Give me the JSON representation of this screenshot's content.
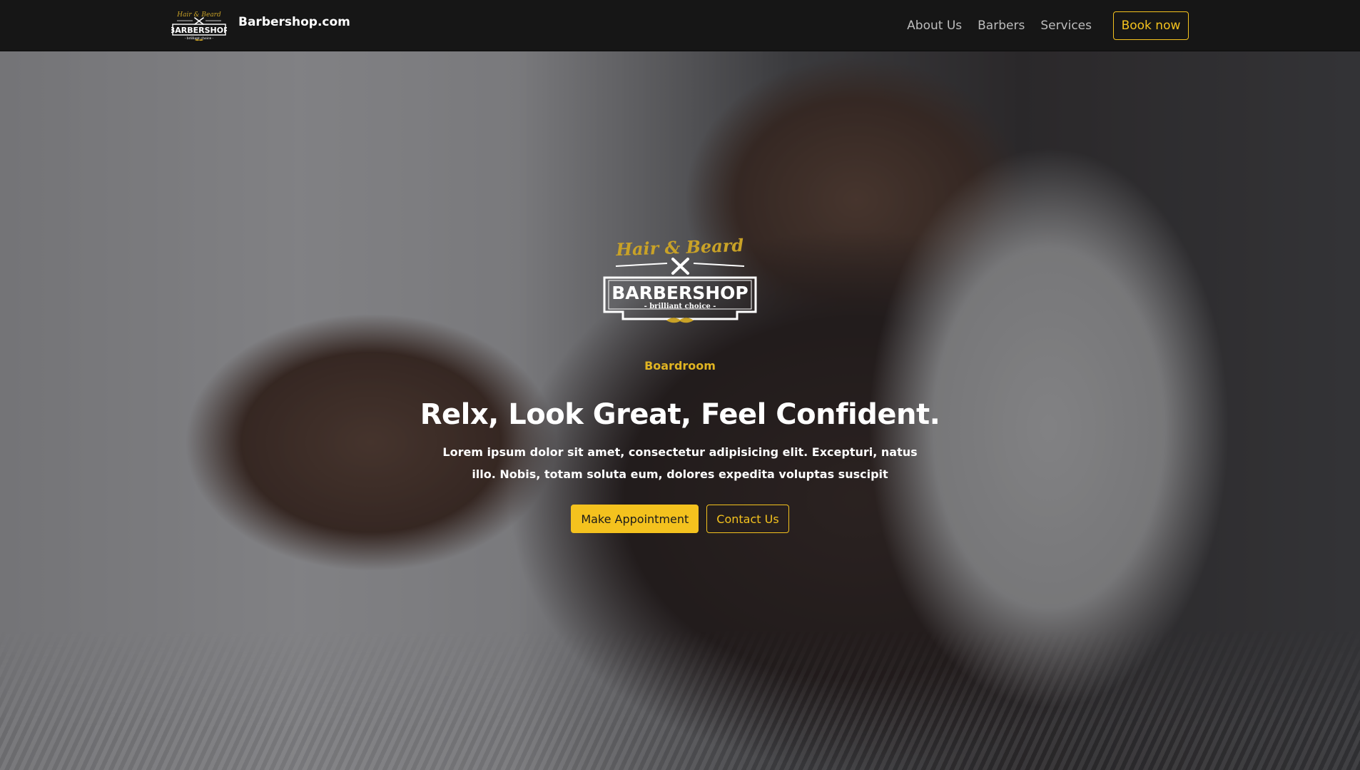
{
  "brand": {
    "name": "Barbershop.com",
    "logo": {
      "script": "Hair & Beard",
      "word": "BARBERSHOP",
      "tagline": "- brilliant choice -",
      "icon": "crossed-razors-icon"
    }
  },
  "nav": {
    "links": [
      {
        "label": "About Us"
      },
      {
        "label": "Barbers"
      },
      {
        "label": "Services"
      }
    ],
    "cta_label": "Book now"
  },
  "hero": {
    "logo": {
      "script": "Hair & Beard",
      "word": "BARBERSHOP",
      "tagline": "- brilliant choice -",
      "icon": "crossed-razors-icon",
      "mustache": "mustache-icon"
    },
    "eyebrow": "Boardroom",
    "headline": "Relx, Look Great, Feel Confident.",
    "subtext": "Lorem ipsum dolor sit amet, consectetur adipisicing elit. Excepturi, natus illo. Nobis, totam soluta eum, dolores expedita voluptas suscipit",
    "primary_cta": "Make Appointment",
    "secondary_cta": "Contact Us",
    "background_image": "barber-towel-photo"
  },
  "colors": {
    "accent": "#f4c21e",
    "navbar": "#161616",
    "text_light": "#ffffff",
    "nav_link": "#bdbdbd",
    "logo_gold": "#c9a227"
  }
}
